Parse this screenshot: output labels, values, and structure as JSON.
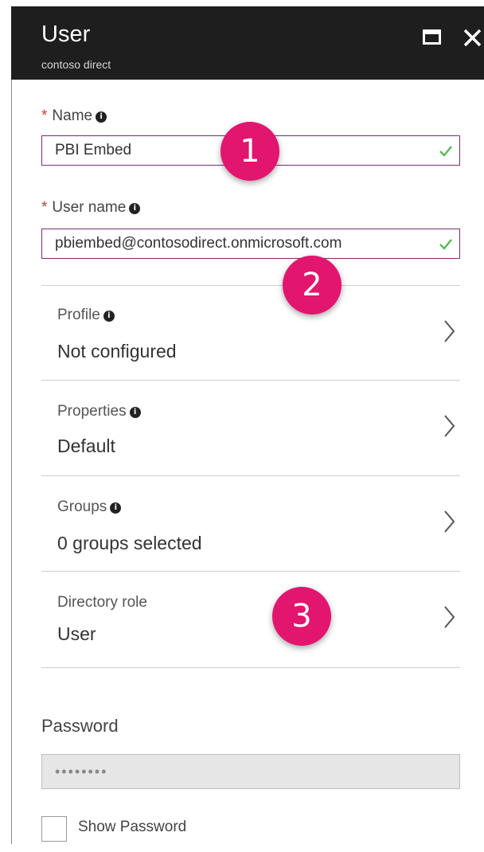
{
  "header": {
    "title": "User",
    "subtitle": "contoso direct",
    "maximize_icon": "maximize-icon",
    "close_icon": "close-icon",
    "background": "#1e1e1e"
  },
  "form": {
    "required_marker": "*",
    "name": {
      "label": "Name",
      "value": "PBI Embed",
      "valid": true
    },
    "username": {
      "label": "User name",
      "value": "pbiembed@contosodirect.onmicrosoft.com",
      "valid": true
    },
    "info_glyph": "i",
    "check_color": "#5cb85c",
    "input_border_color": "#7a2e6c"
  },
  "settings": [
    {
      "label": "Profile",
      "value": "Not configured",
      "has_info": true
    },
    {
      "label": "Properties",
      "value": "Default",
      "has_info": true
    },
    {
      "label": "Groups",
      "value": "0 groups selected",
      "has_info": true
    },
    {
      "label": "Directory role",
      "value": "User",
      "has_info": false
    }
  ],
  "password": {
    "label": "Password",
    "masked_value": "••••••••",
    "show_password_label": "Show Password",
    "show_password_checked": false
  },
  "annotations": {
    "badges": [
      "1",
      "2",
      "3"
    ],
    "color": "#e2156f"
  }
}
